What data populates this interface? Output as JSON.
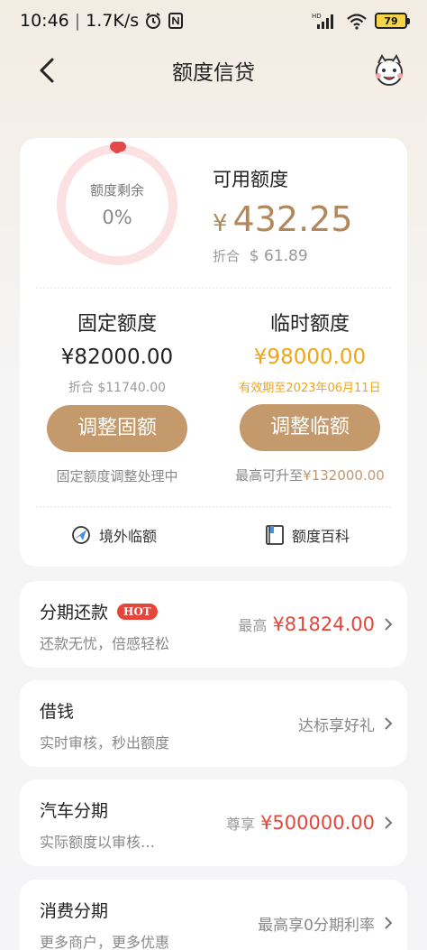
{
  "status_bar": {
    "time": "10:46",
    "network_speed": "1.7K/s",
    "battery": "79",
    "network_badge": "HD",
    "icons": [
      "alarm-icon",
      "nfc-icon",
      "signal-icon",
      "wifi-icon",
      "battery-icon"
    ]
  },
  "nav": {
    "title": "额度信贷",
    "icons": [
      "back-icon",
      "mascot-icon"
    ]
  },
  "credit": {
    "ring_label": "额度剩余",
    "ring_percent": "0%",
    "ring_fraction": 0.0,
    "available_title": "可用额度",
    "available_currency": "¥",
    "available_amount": "432.25",
    "available_sub_prefix": "折合",
    "available_sub_usd": "$ 61.89",
    "fixed": {
      "title": "固定额度",
      "amount": "¥82000.00",
      "sub": "折合 $11740.00",
      "button": "调整固额",
      "note": "固定额度调整处理中"
    },
    "temp": {
      "title": "临时额度",
      "amount": "¥98000.00",
      "valid_until": "有效期至2023年06月11日",
      "button": "调整临额",
      "note_prefix": "最高可升至",
      "note_value": "¥132000.00"
    },
    "tools": [
      {
        "label": "境外临额",
        "icon": "overseas-limit-icon"
      },
      {
        "label": "额度百科",
        "icon": "encyclopedia-book-icon"
      }
    ]
  },
  "services": [
    {
      "title": "分期还款",
      "badge": "HOT",
      "desc": "还款无忧，倍感轻松",
      "right_prefix": "最高",
      "right_value": "¥81824.00",
      "right_plain": ""
    },
    {
      "title": "借钱",
      "badge": "",
      "desc": "实时审核，秒出额度",
      "right_prefix": "",
      "right_value": "",
      "right_plain": "达标享好礼"
    },
    {
      "title": "汽车分期",
      "badge": "",
      "desc": "实际额度以审核…",
      "right_prefix": "尊享",
      "right_value": "¥500000.00",
      "right_plain": ""
    },
    {
      "title": "消费分期",
      "badge": "",
      "desc": "更多商户，更多优惠",
      "right_prefix": "",
      "right_value": "",
      "right_plain": "最高享0分期利率"
    }
  ],
  "colors": {
    "gold": "#c49a6c",
    "amount_gold": "#b0885b",
    "temp_yellow": "#f0a516",
    "red": "#e0483c",
    "ring_bg": "#fbe1e1",
    "ring_dot": "#e44848"
  }
}
